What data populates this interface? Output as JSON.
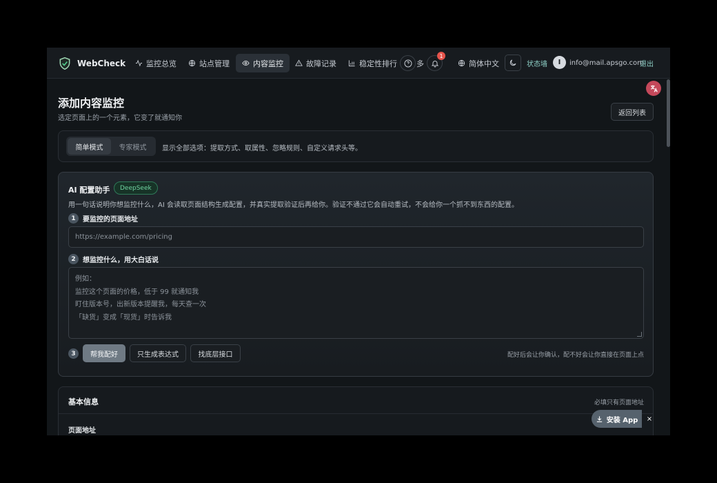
{
  "brand": {
    "title": "WebCheck"
  },
  "nav": {
    "items": [
      {
        "label": "监控总览",
        "icon": "activity-icon"
      },
      {
        "label": "站点管理",
        "icon": "globe-icon"
      },
      {
        "label": "内容监控",
        "icon": "eye-icon",
        "active": true
      },
      {
        "label": "故障记录",
        "icon": "warning-icon"
      },
      {
        "label": "稳定性排行",
        "icon": "bar-chart-icon"
      }
    ],
    "more_label": "多",
    "notification_count": "1",
    "language": "简体中文",
    "status_wall": "状态墙",
    "user_initial": "I",
    "user_email": "info@mail.apsgo.com",
    "logout": "退出"
  },
  "page": {
    "title": "添加内容监控",
    "subtitle": "选定页面上的一个元素，它变了就通知你",
    "back_label": "返回列表"
  },
  "mode": {
    "options": [
      "简单模式",
      "专家模式"
    ],
    "active": "简单模式",
    "description": "显示全部选项：提取方式、取属性、忽略规则、自定义请求头等。"
  },
  "ai": {
    "title": "AI 配置助手",
    "tag": "DeepSeek",
    "description": "用一句话说明你想监控什么，AI 会读取页面结构生成配置，并真实提取验证后再给你。验证不通过它会自动重试，不会给你一个抓不到东西的配置。",
    "step1": {
      "num": "1",
      "label": "要监控的页面地址",
      "placeholder": "https://example.com/pricing"
    },
    "step2": {
      "num": "2",
      "label": "想监控什么，用大白话说",
      "placeholder_lines": [
        "例如：",
        "监控这个页面的价格，低于 99 就通知我",
        "盯住版本号，出新版本提醒我，每天查一次",
        "「缺货」变成「现货」时告诉我"
      ]
    },
    "step3": {
      "num": "3"
    },
    "buttons": {
      "primary": "帮我配好",
      "expression": "只生成表达式",
      "api": "找底层接口"
    },
    "hint": "配好后会让你确认，配不好会让你直接在页面上点"
  },
  "basic": {
    "title": "基本信息",
    "note": "必填只有页面地址",
    "field_label": "页面地址"
  },
  "install": {
    "label": "安装 App",
    "close": "×"
  }
}
